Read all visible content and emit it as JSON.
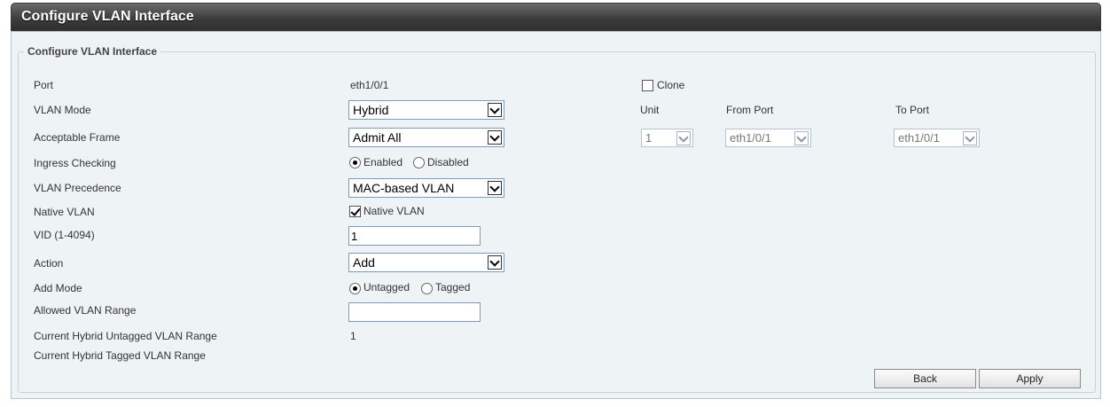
{
  "window": {
    "title": "Configure VLAN Interface"
  },
  "section": {
    "legend": "Configure VLAN Interface"
  },
  "labels": {
    "port": "Port",
    "vlan_mode": "VLAN Mode",
    "acceptable_frame": "Acceptable Frame",
    "ingress_checking": "Ingress Checking",
    "vlan_precedence": "VLAN Precedence",
    "native_vlan": "Native VLAN",
    "vid": "VID (1-4094)",
    "action": "Action",
    "add_mode": "Add Mode",
    "allowed_vlan_range": "Allowed VLAN Range",
    "current_untagged": "Current Hybrid Untagged VLAN Range",
    "current_tagged": "Current Hybrid Tagged VLAN Range"
  },
  "values": {
    "port": "eth1/0/1",
    "vlan_mode": "Hybrid",
    "acceptable_frame": "Admit All",
    "ingress_enabled": "Enabled",
    "ingress_disabled": "Disabled",
    "vlan_precedence": "MAC-based VLAN",
    "native_vlan_checkbox": "Native VLAN",
    "vid": "1",
    "action": "Add",
    "add_mode_untagged": "Untagged",
    "add_mode_tagged": "Tagged",
    "allowed_vlan_range": "",
    "current_untagged": "1",
    "current_tagged": ""
  },
  "clone": {
    "label": "Clone",
    "unit_header": "Unit",
    "from_port_header": "From Port",
    "to_port_header": "To Port",
    "unit_value": "1",
    "from_port_value": "eth1/0/1",
    "to_port_value": "eth1/0/1"
  },
  "buttons": {
    "back": "Back",
    "apply": "Apply"
  }
}
